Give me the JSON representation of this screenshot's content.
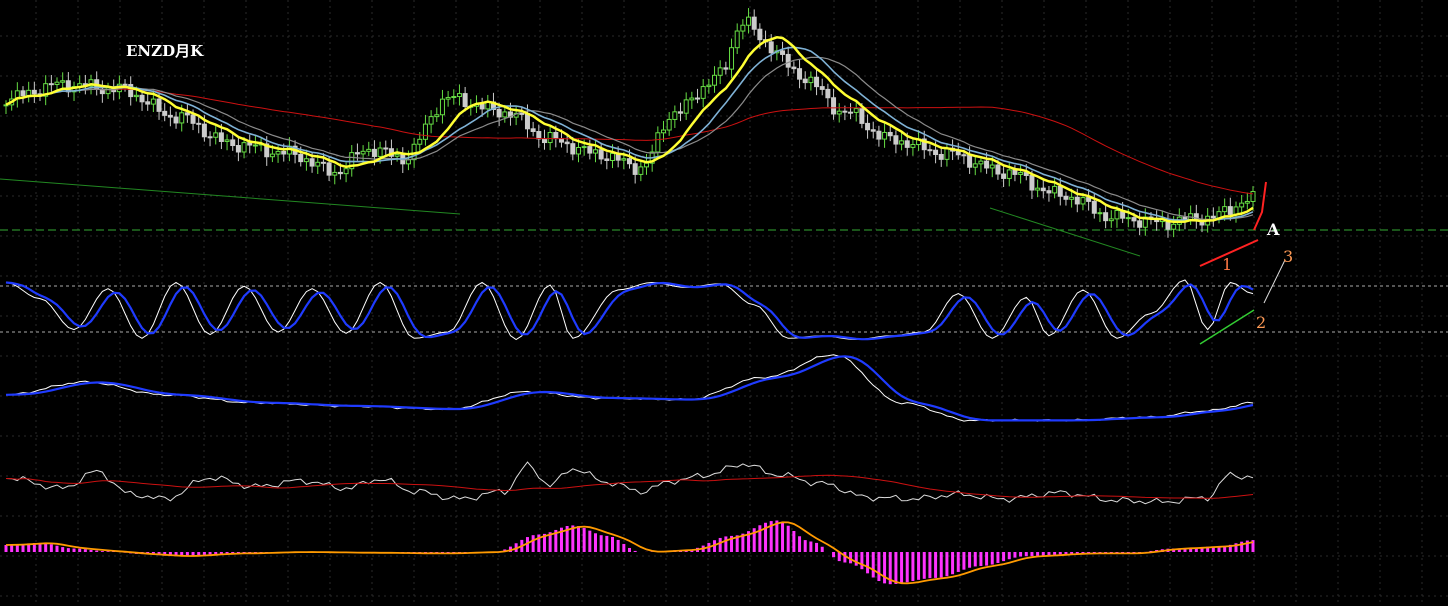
{
  "chart_data": {
    "type": "candlestick",
    "title": "ENZD月K",
    "grid": true,
    "panels": [
      {
        "name": "price",
        "ylim": [
          0,
          100
        ],
        "series": [
          {
            "key": "ma_fast",
            "color": "#ffff33"
          },
          {
            "key": "ma_mid",
            "color": "#7fb2d6"
          },
          {
            "key": "ma_mid2",
            "color": "#8b8b8b"
          },
          {
            "key": "ma_slow",
            "color": "#cc1111"
          }
        ]
      },
      {
        "name": "kdj",
        "ylim": [
          0,
          100
        ],
        "series": [
          {
            "key": "k",
            "color": "#ffffff"
          },
          {
            "key": "d",
            "color": "#1f3bff"
          }
        ]
      },
      {
        "name": "macd_lines",
        "ylim": [
          0,
          100
        ],
        "series": [
          {
            "key": "dif",
            "color": "#ffffff"
          },
          {
            "key": "dea",
            "color": "#1f3bff"
          }
        ]
      },
      {
        "name": "rsi",
        "ylim": [
          0,
          100
        ],
        "series": [
          {
            "key": "rsi",
            "color": "#dddddd"
          },
          {
            "key": "rsi_ma",
            "color": "#cc1111"
          }
        ]
      },
      {
        "name": "macd_hist",
        "ylim": [
          -100,
          100
        ],
        "series": [
          {
            "key": "signal",
            "color": "#ff9a00"
          },
          {
            "key": "hist",
            "color": "#ff33ff"
          }
        ]
      }
    ],
    "price_anchors": [
      [
        0,
        66
      ],
      [
        10,
        72
      ],
      [
        20,
        70
      ],
      [
        30,
        58
      ],
      [
        40,
        46
      ],
      [
        50,
        42
      ],
      [
        58,
        34
      ],
      [
        64,
        44
      ],
      [
        70,
        40
      ],
      [
        78,
        66
      ],
      [
        88,
        60
      ],
      [
        96,
        48
      ],
      [
        104,
        42
      ],
      [
        112,
        36
      ],
      [
        118,
        60
      ],
      [
        126,
        76
      ],
      [
        130,
        100
      ],
      [
        134,
        90
      ],
      [
        140,
        76
      ],
      [
        148,
        60
      ],
      [
        156,
        48
      ],
      [
        166,
        42
      ],
      [
        176,
        34
      ],
      [
        186,
        24
      ],
      [
        196,
        14
      ],
      [
        204,
        12
      ],
      [
        212,
        14
      ],
      [
        220,
        22
      ]
    ],
    "kdj_anchors": [
      [
        0,
        96
      ],
      [
        6,
        70
      ],
      [
        12,
        20
      ],
      [
        18,
        86
      ],
      [
        24,
        6
      ],
      [
        30,
        96
      ],
      [
        36,
        12
      ],
      [
        42,
        90
      ],
      [
        48,
        16
      ],
      [
        54,
        86
      ],
      [
        60,
        14
      ],
      [
        66,
        96
      ],
      [
        72,
        6
      ],
      [
        78,
        16
      ],
      [
        84,
        96
      ],
      [
        90,
        4
      ],
      [
        96,
        92
      ],
      [
        100,
        6
      ],
      [
        108,
        84
      ],
      [
        114,
        96
      ],
      [
        120,
        88
      ],
      [
        126,
        94
      ],
      [
        132,
        60
      ],
      [
        138,
        6
      ],
      [
        144,
        10
      ],
      [
        150,
        4
      ],
      [
        156,
        10
      ],
      [
        162,
        16
      ],
      [
        168,
        78
      ],
      [
        174,
        6
      ],
      [
        180,
        72
      ],
      [
        184,
        10
      ],
      [
        190,
        84
      ],
      [
        196,
        6
      ],
      [
        202,
        46
      ],
      [
        208,
        100
      ],
      [
        212,
        20
      ],
      [
        216,
        96
      ],
      [
        220,
        78
      ]
    ],
    "macd_anchors": [
      [
        0,
        44
      ],
      [
        14,
        60
      ],
      [
        28,
        44
      ],
      [
        44,
        34
      ],
      [
        60,
        30
      ],
      [
        78,
        26
      ],
      [
        92,
        48
      ],
      [
        104,
        40
      ],
      [
        120,
        38
      ],
      [
        134,
        66
      ],
      [
        146,
        94
      ],
      [
        158,
        34
      ],
      [
        170,
        12
      ],
      [
        186,
        12
      ],
      [
        202,
        16
      ],
      [
        212,
        24
      ],
      [
        220,
        34
      ]
    ],
    "rsi_anchors": [
      [
        0,
        40
      ],
      [
        10,
        26
      ],
      [
        16,
        48
      ],
      [
        22,
        18
      ],
      [
        28,
        12
      ],
      [
        36,
        40
      ],
      [
        44,
        28
      ],
      [
        52,
        36
      ],
      [
        60,
        26
      ],
      [
        66,
        38
      ],
      [
        72,
        22
      ],
      [
        80,
        12
      ],
      [
        88,
        22
      ],
      [
        92,
        56
      ],
      [
        96,
        30
      ],
      [
        100,
        52
      ],
      [
        106,
        34
      ],
      [
        112,
        22
      ],
      [
        118,
        36
      ],
      [
        124,
        44
      ],
      [
        130,
        58
      ],
      [
        136,
        44
      ],
      [
        144,
        32
      ],
      [
        152,
        14
      ],
      [
        160,
        12
      ],
      [
        168,
        18
      ],
      [
        176,
        12
      ],
      [
        186,
        20
      ],
      [
        196,
        10
      ],
      [
        204,
        8
      ],
      [
        212,
        14
      ],
      [
        216,
        44
      ],
      [
        220,
        40
      ]
    ],
    "hist_anchors": [
      [
        0,
        20
      ],
      [
        6,
        26
      ],
      [
        12,
        10
      ],
      [
        18,
        2
      ],
      [
        24,
        -6
      ],
      [
        30,
        -12
      ],
      [
        40,
        -4
      ],
      [
        52,
        0
      ],
      [
        62,
        -2
      ],
      [
        76,
        -4
      ],
      [
        86,
        0
      ],
      [
        94,
        50
      ],
      [
        100,
        76
      ],
      [
        106,
        46
      ],
      [
        112,
        0
      ],
      [
        120,
        6
      ],
      [
        128,
        46
      ],
      [
        136,
        90
      ],
      [
        142,
        30
      ],
      [
        148,
        -30
      ],
      [
        156,
        -92
      ],
      [
        164,
        -74
      ],
      [
        172,
        -40
      ],
      [
        180,
        -12
      ],
      [
        190,
        -4
      ],
      [
        198,
        -4
      ],
      [
        206,
        10
      ],
      [
        214,
        16
      ],
      [
        220,
        34
      ]
    ],
    "annotations": [
      {
        "text": "A",
        "color": "#ffffff"
      },
      {
        "text": "1",
        "color": "#ff7744"
      },
      {
        "text": "2",
        "color": "#ff9a55"
      },
      {
        "text": "3",
        "color": "#ff9a55"
      }
    ]
  }
}
